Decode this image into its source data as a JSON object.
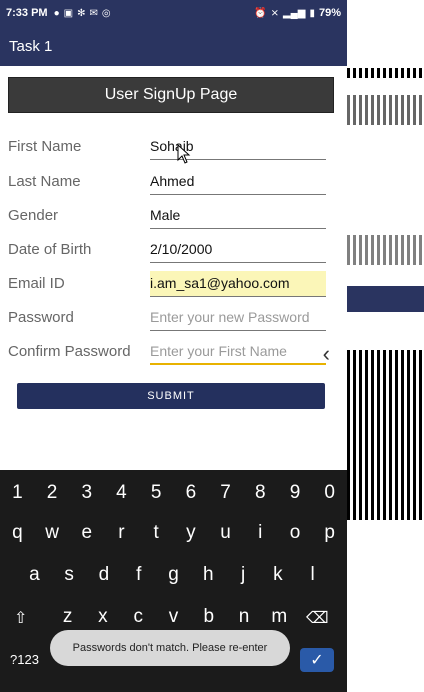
{
  "status_bar": {
    "time": "7:33 PM",
    "battery": "79%"
  },
  "app_bar": {
    "title": "Task 1"
  },
  "header": {
    "label": "User SignUp Page"
  },
  "form": {
    "first_name": {
      "label": "First Name",
      "value": "Sohaib"
    },
    "last_name": {
      "label": "Last Name",
      "value": "Ahmed"
    },
    "gender": {
      "label": "Gender",
      "value": "Male"
    },
    "dob": {
      "label": "Date of Birth",
      "value": "2/10/2000"
    },
    "email": {
      "label": "Email ID",
      "value": "i.am_sa1@yahoo.com"
    },
    "password": {
      "label": "Password",
      "placeholder": "Enter your new Password"
    },
    "confirm": {
      "label": "Confirm Password",
      "placeholder": "Enter your First Name"
    }
  },
  "submit": {
    "label": "SUBMIT"
  },
  "keyboard": {
    "numbers": [
      "1",
      "2",
      "3",
      "4",
      "5",
      "6",
      "7",
      "8",
      "9",
      "0"
    ],
    "row1": [
      "q",
      "w",
      "e",
      "r",
      "t",
      "y",
      "u",
      "i",
      "o",
      "p"
    ],
    "row2": [
      "a",
      "s",
      "d",
      "f",
      "g",
      "h",
      "j",
      "k",
      "l"
    ],
    "row3": [
      "z",
      "x",
      "c",
      "v",
      "b",
      "n",
      "m"
    ],
    "symbols_key": "?123"
  },
  "toast": {
    "message": "Passwords don't match. Please re-enter"
  },
  "colors": {
    "primary": "#2a3460",
    "submit": "#24305e",
    "highlight": "#fbf6b8",
    "accent": "#e8b200"
  }
}
